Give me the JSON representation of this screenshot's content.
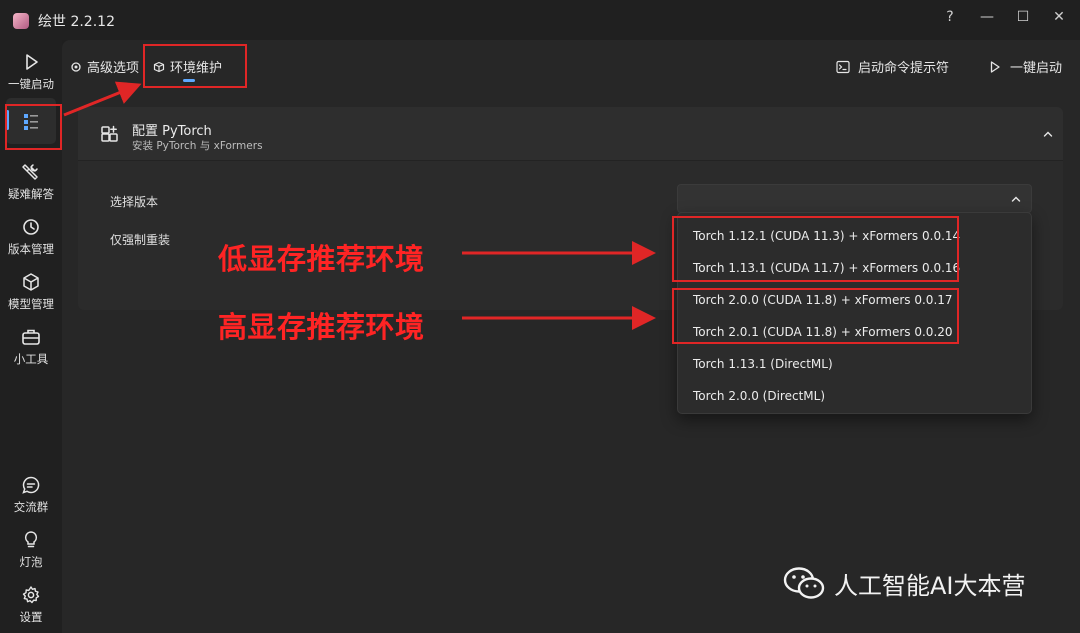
{
  "window": {
    "title": "绘世 2.2.12",
    "help": "?",
    "minimize": "—",
    "maximize": "☐",
    "close": "✕"
  },
  "sidebar": {
    "items": [
      {
        "label": "一键启动",
        "icon": "play-icon"
      },
      {
        "label": "",
        "icon": "list-icon"
      },
      {
        "label": "疑难解答",
        "icon": "tools-icon"
      },
      {
        "label": "版本管理",
        "icon": "history-icon"
      },
      {
        "label": "模型管理",
        "icon": "cube-icon"
      },
      {
        "label": "小工具",
        "icon": "toolbox-icon"
      },
      {
        "label": "交流群",
        "icon": "chat-icon"
      },
      {
        "label": "灯泡",
        "icon": "bulb-icon"
      },
      {
        "label": "设置",
        "icon": "gear-icon"
      }
    ]
  },
  "tabs": [
    {
      "label": "高级选项",
      "icon": "gear-small-icon"
    },
    {
      "label": "环境维护",
      "icon": "box-icon"
    }
  ],
  "toolbar": {
    "terminal_label": "启动命令提示符",
    "launch_label": "一键启动"
  },
  "panel": {
    "title": "配置 PyTorch",
    "subtitle": "安装 PyTorch 与 xFormers",
    "rows": {
      "select_version": "选择版本",
      "force_reinstall": "仅强制重装"
    }
  },
  "dropdown": {
    "selected": "",
    "options": [
      "Torch 1.12.1 (CUDA 11.3) + xFormers 0.0.14",
      "Torch 1.13.1 (CUDA 11.7) + xFormers 0.0.16",
      "Torch 2.0.0 (CUDA 11.8) + xFormers 0.0.17",
      "Torch 2.0.1 (CUDA 11.8) + xFormers 0.0.20",
      "Torch 1.13.1 (DirectML)",
      "Torch 2.0.0 (DirectML)"
    ]
  },
  "annotations": {
    "low_vram": "低显存推荐环境",
    "high_vram": "高显存推荐环境"
  },
  "watermark": "人工智能AI大本营",
  "colors": {
    "accent": "#5ea8ff",
    "annotation": "#e02626"
  }
}
